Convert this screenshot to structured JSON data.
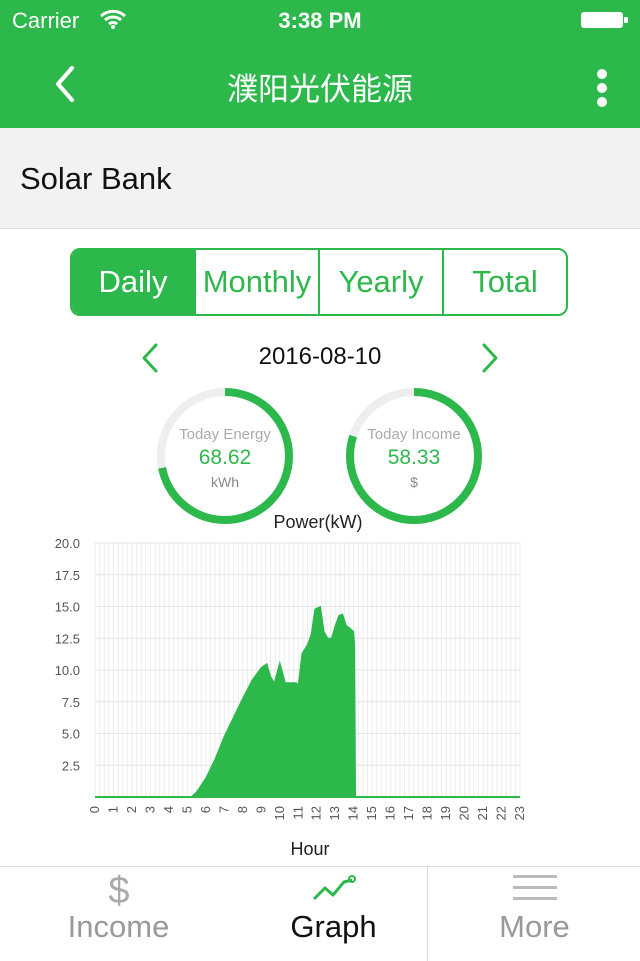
{
  "status": {
    "carrier": "Carrier",
    "time": "3:38 PM"
  },
  "navbar": {
    "title": "濮阳光伏能源",
    "back_icon": "chevron-left-icon",
    "menu_icon": "vertical-ellipsis-icon"
  },
  "station": {
    "name": "Solar Bank"
  },
  "segments": [
    "Daily",
    "Monthly",
    "Yearly",
    "Total"
  ],
  "selected_segment": "Daily",
  "date": "2016-08-10",
  "gauges": {
    "energy": {
      "label": "Today Energy",
      "value": "68.62",
      "unit": "kWh",
      "level": 0.72
    },
    "income": {
      "label": "Today Income",
      "value": "58.33",
      "unit": "$",
      "level": 0.8
    }
  },
  "tabs": {
    "income": {
      "label": "Income",
      "icon": "dollar-icon"
    },
    "graph": {
      "label": "Graph",
      "icon": "line-graph-icon"
    },
    "more": {
      "label": "More",
      "icon": "hamburger-menu-icon"
    }
  },
  "colors": {
    "accent": "#2db84c",
    "gauge_track": "#eeeeee"
  },
  "chart_data": {
    "type": "area",
    "title": "Power(kW)",
    "xlabel": "Hour",
    "ylabel": "",
    "ylim": [
      0,
      20
    ],
    "yticks": [
      "20.0",
      "17.5",
      "15.0",
      "12.5",
      "10.0",
      "7.5",
      "5.0",
      "2.5"
    ],
    "xticks": [
      "0",
      "1",
      "2",
      "3",
      "4",
      "5",
      "6",
      "7",
      "8",
      "9",
      "10",
      "11",
      "12",
      "13",
      "14",
      "15",
      "16",
      "17",
      "18",
      "19",
      "20",
      "21",
      "22",
      "23"
    ],
    "grid": true,
    "series": [
      {
        "x": [
          0,
          5.2,
          5.5,
          6,
          6.5,
          7,
          7.5,
          8,
          8.5,
          9,
          9.3,
          9.5,
          9.7,
          10,
          10.3,
          10.6,
          10.9,
          11,
          11.2,
          11.5,
          11.7,
          11.9,
          12.2,
          12.4,
          12.6,
          12.8,
          13,
          13.2,
          13.4,
          13.6,
          13.8,
          14,
          14.05,
          14.1,
          23
        ],
        "y": [
          0,
          0,
          0.4,
          1.5,
          3.0,
          4.8,
          6.3,
          7.8,
          9.2,
          10.2,
          10.5,
          9.5,
          9.0,
          10.6,
          9.0,
          9.0,
          9.0,
          8.8,
          11.3,
          12.0,
          12.8,
          14.8,
          15.0,
          13.0,
          12.5,
          12.5,
          13.5,
          14.3,
          14.4,
          13.5,
          13.3,
          13.0,
          12.0,
          0,
          0
        ]
      }
    ]
  }
}
